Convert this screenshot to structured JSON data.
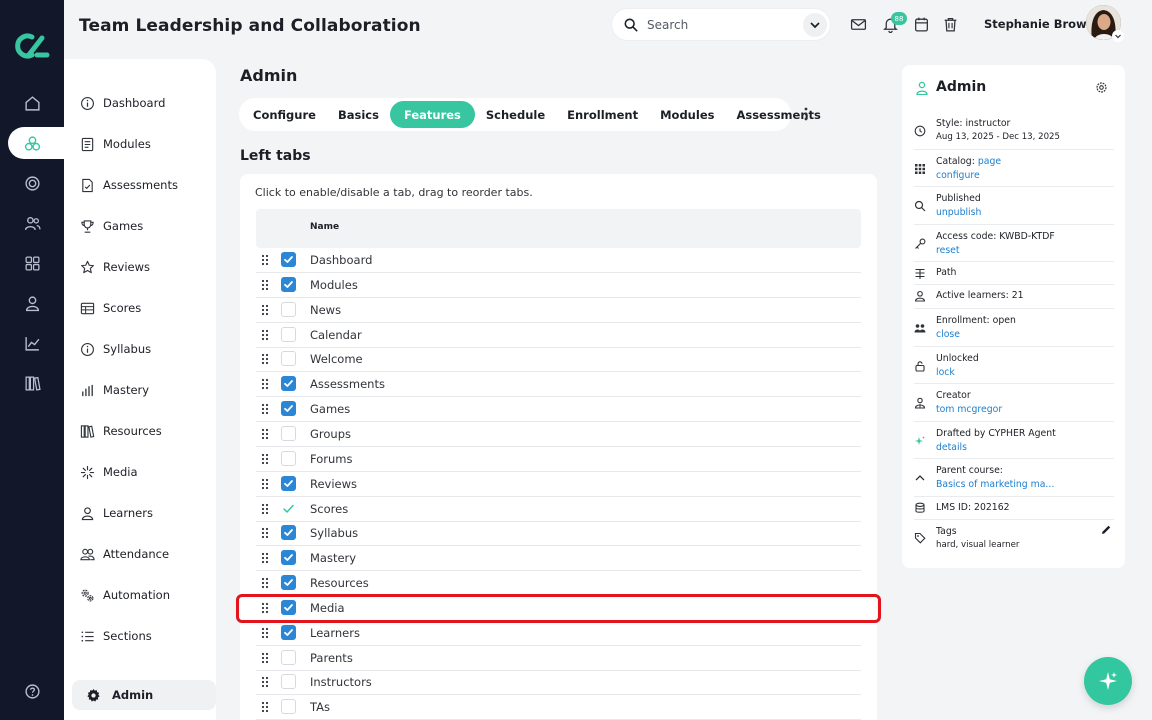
{
  "header": {
    "title": "Team Leadership and Collaboration",
    "search_placeholder": "Search",
    "notification_count": "88",
    "user_name": "Stephanie Brown"
  },
  "rail": {
    "icons": [
      "home-icon",
      "modules-icon",
      "target-icon",
      "people-icon",
      "grid-icon",
      "person-icon",
      "chart-icon",
      "library-icon",
      "help-icon"
    ]
  },
  "course_nav": {
    "items": [
      {
        "label": "Dashboard",
        "icon": "info-icon"
      },
      {
        "label": "Modules",
        "icon": "modules-list-icon"
      },
      {
        "label": "Assessments",
        "icon": "assessment-icon"
      },
      {
        "label": "Games",
        "icon": "trophy-icon"
      },
      {
        "label": "Reviews",
        "icon": "star-icon"
      },
      {
        "label": "Scores",
        "icon": "table-icon"
      },
      {
        "label": "Syllabus",
        "icon": "info-icon"
      },
      {
        "label": "Mastery",
        "icon": "bars-icon"
      },
      {
        "label": "Resources",
        "icon": "books-icon"
      },
      {
        "label": "Media",
        "icon": "sparkle-icon"
      },
      {
        "label": "Learners",
        "icon": "person-icon"
      },
      {
        "label": "Attendance",
        "icon": "people-icon"
      },
      {
        "label": "Automation",
        "icon": "gears-icon"
      },
      {
        "label": "Sections",
        "icon": "list-icon"
      }
    ],
    "admin_label": "Admin"
  },
  "main": {
    "title": "Admin",
    "tabs": [
      "Configure",
      "Basics",
      "Features",
      "Schedule",
      "Enrollment",
      "Modules",
      "Assessments"
    ],
    "active_tab": "Features",
    "section_title": "Left tabs",
    "hint": "Click to enable/disable a tab, drag to reorder tabs.",
    "column_name": "Name",
    "rows": [
      {
        "label": "Dashboard",
        "state": "checked"
      },
      {
        "label": "Modules",
        "state": "checked"
      },
      {
        "label": "News",
        "state": "unchecked"
      },
      {
        "label": "Calendar",
        "state": "unchecked"
      },
      {
        "label": "Welcome",
        "state": "unchecked"
      },
      {
        "label": "Assessments",
        "state": "checked"
      },
      {
        "label": "Games",
        "state": "checked"
      },
      {
        "label": "Groups",
        "state": "unchecked"
      },
      {
        "label": "Forums",
        "state": "unchecked"
      },
      {
        "label": "Reviews",
        "state": "checked"
      },
      {
        "label": "Scores",
        "state": "tick"
      },
      {
        "label": "Syllabus",
        "state": "checked"
      },
      {
        "label": "Mastery",
        "state": "checked"
      },
      {
        "label": "Resources",
        "state": "checked"
      },
      {
        "label": "Media",
        "state": "checked"
      },
      {
        "label": "Learners",
        "state": "checked"
      },
      {
        "label": "Parents",
        "state": "unchecked"
      },
      {
        "label": "Instructors",
        "state": "unchecked"
      },
      {
        "label": "TAs",
        "state": "unchecked"
      }
    ]
  },
  "info_panel": {
    "title": "Admin",
    "rows": [
      {
        "icon": "clock-icon",
        "line1": "Style: instructor",
        "line2": "Aug 13, 2025 - Dec 13, 2025",
        "line2_link": false
      },
      {
        "icon": "catalog-icon",
        "line1": "Catalog:",
        "line1_link": "page",
        "line2": "configure",
        "line2_link": true
      },
      {
        "icon": "search-icon",
        "line1": "Published",
        "line2": "unpublish",
        "line2_link": true
      },
      {
        "icon": "key-icon",
        "line1": "Access code: KWBD-KTDF",
        "line2": "reset",
        "line2_link": true
      },
      {
        "icon": "path-icon",
        "line1": "Path",
        "line2": ""
      },
      {
        "icon": "person-icon",
        "line1": "Active learners: 21",
        "line2": ""
      },
      {
        "icon": "people-icon",
        "line1": "Enrollment: open",
        "line2": "close",
        "line2_link": true
      },
      {
        "icon": "lock-icon",
        "line1": "Unlocked",
        "line2": "lock",
        "line2_link": true
      },
      {
        "icon": "creator-icon",
        "line1": "Creator",
        "line2": "tom mcgregor",
        "line2_link": true
      },
      {
        "icon": "sparkle-icon",
        "line1": "Drafted by CYPHER Agent",
        "line2": "details",
        "line2_link": true
      },
      {
        "icon": "chevron-up-icon",
        "line1": "Parent course:",
        "line2": "Basics of marketing ma...",
        "line2_link": true
      },
      {
        "icon": "database-icon",
        "line1": "LMS ID: 202162",
        "line2": ""
      },
      {
        "icon": "tag-icon",
        "line1": "Tags",
        "line2": "hard, visual learner",
        "line2_link": false
      }
    ]
  },
  "colors": {
    "accent": "#37c6a0",
    "rail_bg": "#12172a",
    "checkbox": "#2b86d6",
    "link": "#1c7fcf",
    "highlight": "#e3141b"
  }
}
